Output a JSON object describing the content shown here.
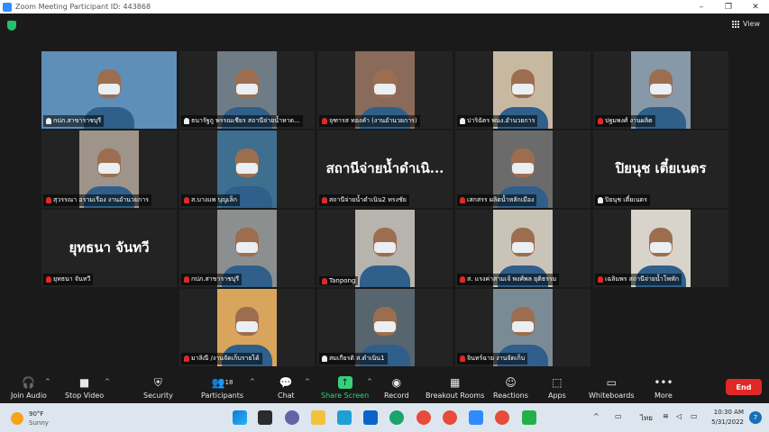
{
  "window": {
    "title": "Zoom Meeting Participant ID: 443868",
    "minimize": "–",
    "maximize": "❐",
    "close": "✕"
  },
  "top": {
    "view_label": "View"
  },
  "participants": [
    {
      "name": "กปภ.สาขาราชบุรี",
      "muted": false,
      "active": true,
      "bg": "#5f8fb8"
    },
    {
      "name": "ธนารัฐถู พรรณเชียร สถานีจ่ายน้ำหาด...",
      "muted": false,
      "bg": "#6f7c86"
    },
    {
      "name": "จุฑารส ทองคำ (งานอำนวยการ)",
      "muted": true,
      "bg": "#8a6a5a"
    },
    {
      "name": "ปาริฉัตร พนง.อำนวยการ",
      "muted": false,
      "bg": "#c7b8a2"
    },
    {
      "name": "ปฐมพงศ์ งานผลิต",
      "muted": true,
      "bg": "#8798a8"
    },
    {
      "name": "สุวรรณา อรามเรือง งานอำนวยการ",
      "muted": true,
      "bg": "#9f9489"
    },
    {
      "name": "ส.บางแพ บุญเล็ก",
      "muted": true,
      "bg": "#3e6f8f"
    },
    {
      "name": "สถานีจ่ายน้ำดำเนิน2 ทรงชัย",
      "muted": true,
      "big": "สถานีจ่ายน้ำดำเนิ..."
    },
    {
      "name": "เสกสรร ผลิตน้ำหลักเมือง",
      "muted": true,
      "bg": "#6b6b6b"
    },
    {
      "name": "ปิยนุช เตี๋ยเนตร",
      "muted": false,
      "big": "ปิยนุช  เตี๋ยเนตร"
    },
    {
      "name": "ยุทธนา จันทวี",
      "muted": true,
      "big": "ยุทธนา  จันทวี"
    },
    {
      "name": "กปภ.สาขาราชบุรี",
      "muted": true,
      "bg": "#8c8f90"
    },
    {
      "name": "Tanpong",
      "muted": true,
      "bg": "#b7b3ad"
    },
    {
      "name": "ส. แรงค่าสามเจ้ พงศ์พล ยุติธรรม",
      "muted": true,
      "bg": "#c9c3b8"
    },
    {
      "name": "เฉลิมพร สถานีจ่ายน้ำโพหัก",
      "muted": true,
      "bg": "#d8d4cc"
    },
    {
      "name": "มาลิณี /งานจัดเก็บรายได้",
      "muted": true,
      "bg": "#d9a55c"
    },
    {
      "name": "สมเกียรติ ส.ดำเนิน1",
      "muted": false,
      "bg": "#57656e"
    },
    {
      "name": "จินทร์ฉาย งานจัดเก็บ",
      "muted": true,
      "bg": "#7a8b96"
    }
  ],
  "toolbar": {
    "join_audio": "Join Audio",
    "stop_video": "Stop Video",
    "security": "Security",
    "participants": "Participants",
    "participants_count": "18",
    "chat": "Chat",
    "share_screen": "Share Screen",
    "record": "Record",
    "breakout_rooms": "Breakout Rooms",
    "reactions": "Reactions",
    "apps": "Apps",
    "whiteboards": "Whiteboards",
    "more": "More",
    "end": "End"
  },
  "taskbar": {
    "temperature": "90°F",
    "condition": "Sunny",
    "language": "ไทย",
    "time": "10:30 AM",
    "date": "5/31/2022",
    "notifications": "7"
  },
  "colors": {
    "accent_green": "#33d17a",
    "end_red": "#e02828",
    "active_outline": "#d9e63a"
  }
}
